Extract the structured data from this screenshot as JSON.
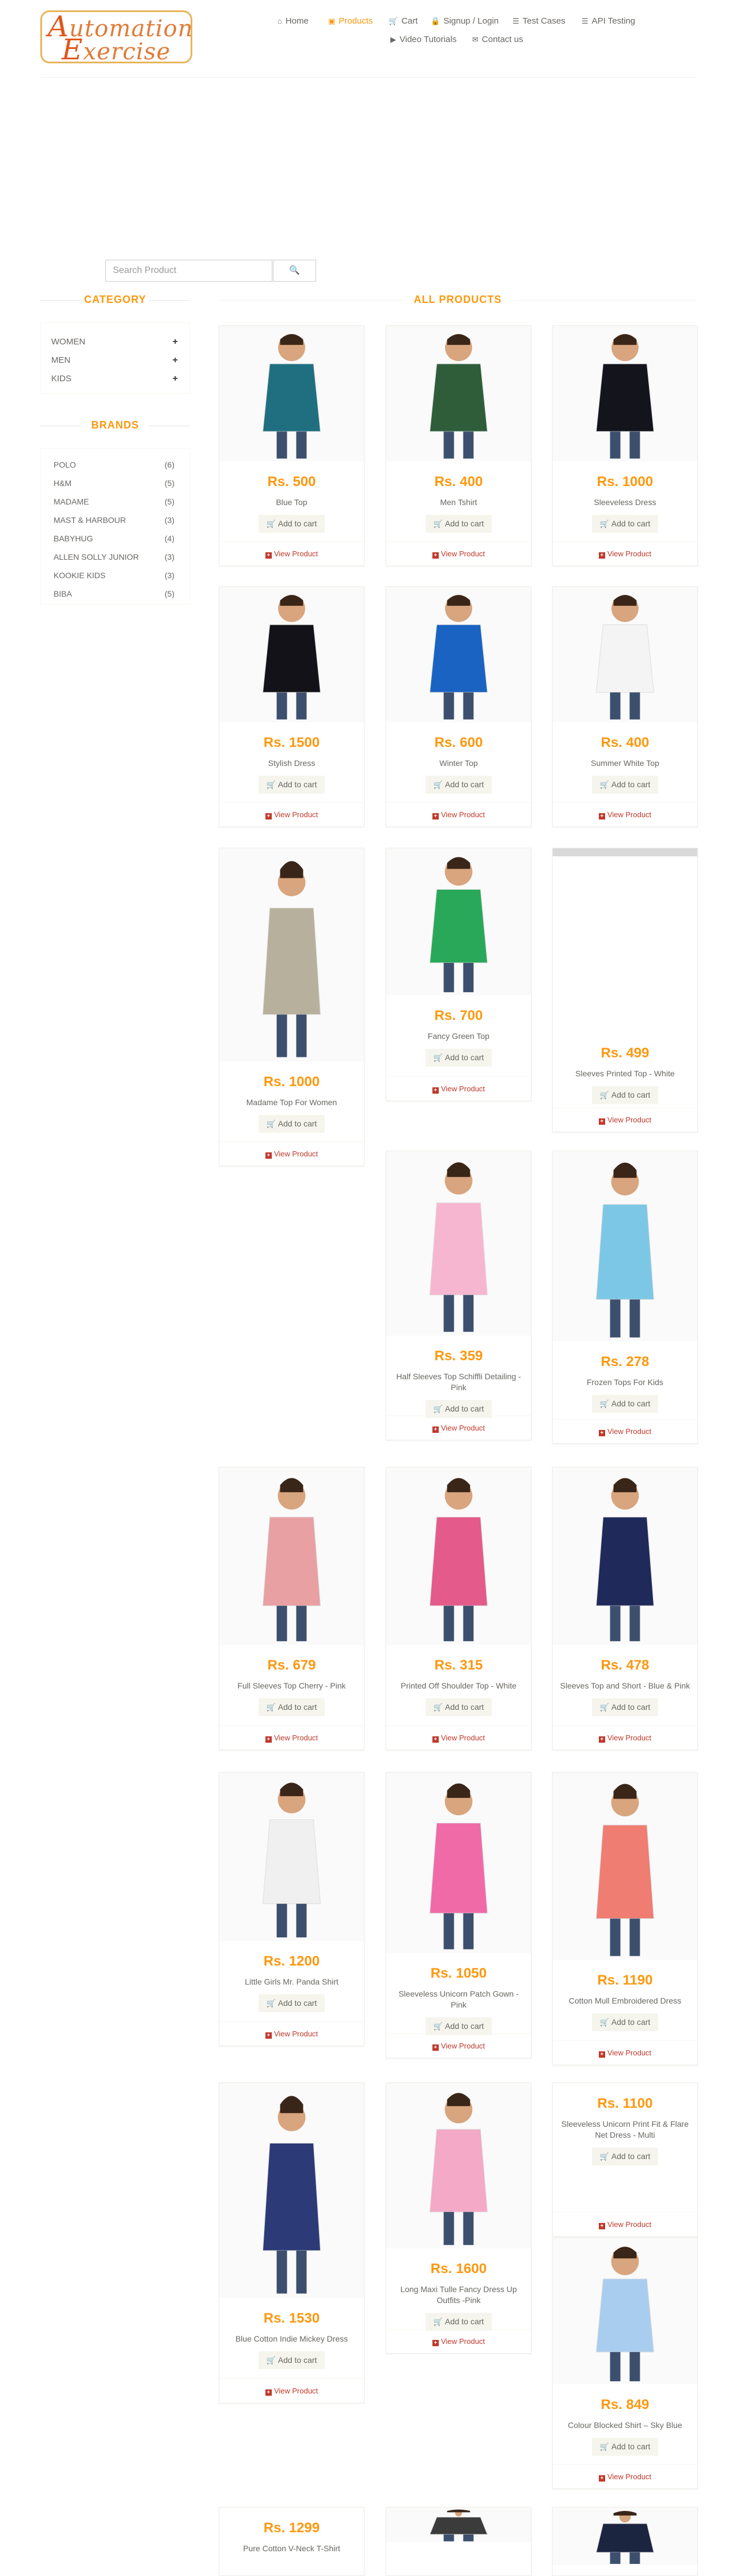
{
  "header": {
    "logo": {
      "line1": "Automation",
      "line2": "Exercise"
    },
    "nav": [
      {
        "label": "Home",
        "icon": "home-icon",
        "glyph": "⌂",
        "active": false
      },
      {
        "label": "Products",
        "icon": "products-icon",
        "glyph": "▣",
        "active": true
      },
      {
        "label": "Cart",
        "icon": "cart-icon",
        "glyph": "🛒",
        "active": false
      },
      {
        "label": "Signup / Login",
        "icon": "lock-icon",
        "glyph": "🔒",
        "active": false
      },
      {
        "label": "Test Cases",
        "icon": "list-icon",
        "glyph": "☰",
        "active": false
      },
      {
        "label": "API Testing",
        "icon": "list-icon",
        "glyph": "☰",
        "active": false
      },
      {
        "label": "Video Tutorials",
        "icon": "youtube-icon",
        "glyph": "▶",
        "active": false
      },
      {
        "label": "Contact us",
        "icon": "envelope-icon",
        "glyph": "✉",
        "active": false
      }
    ]
  },
  "search": {
    "placeholder": "Search Product",
    "button_icon": "search-icon",
    "button_glyph": "🔍"
  },
  "sidebar": {
    "category_title": "CATEGORY",
    "categories": [
      {
        "label": "WOMEN",
        "toggle": "+"
      },
      {
        "label": "MEN",
        "toggle": "+"
      },
      {
        "label": "KIDS",
        "toggle": "+"
      }
    ],
    "brands_title": "BRANDS",
    "brands": [
      {
        "label": "POLO",
        "count": "(6)"
      },
      {
        "label": "H&M",
        "count": "(5)"
      },
      {
        "label": "MADAME",
        "count": "(5)"
      },
      {
        "label": "MAST & HARBOUR",
        "count": "(3)"
      },
      {
        "label": "BABYHUG",
        "count": "(4)"
      },
      {
        "label": "ALLEN SOLLY JUNIOR",
        "count": "(3)"
      },
      {
        "label": "KOOKIE KIDS",
        "count": "(3)"
      },
      {
        "label": "BIBA",
        "count": "(5)"
      }
    ]
  },
  "products_section": {
    "title": "ALL PRODUCTS",
    "add_to_cart": "Add to cart",
    "view_product": "View Product"
  },
  "products": [
    {
      "name": "Blue Top",
      "price": "Rs. 500",
      "color": "#1f6f80"
    },
    {
      "name": "Men Tshirt",
      "price": "Rs. 400",
      "color": "#2f5d3a"
    },
    {
      "name": "Sleeveless Dress",
      "price": "Rs. 1000",
      "color": "#14141c"
    },
    {
      "name": "Stylish Dress",
      "price": "Rs. 1500",
      "color": "#121218"
    },
    {
      "name": "Winter Top",
      "price": "Rs. 600",
      "color": "#1a63c2"
    },
    {
      "name": "Summer White Top",
      "price": "Rs. 400",
      "color": "#f4f4f4"
    },
    {
      "name": "Madame Top For Women",
      "price": "Rs. 1000",
      "color": "#b7b09c"
    },
    {
      "name": "Fancy Green Top",
      "price": "Rs. 700",
      "color": "#2aa85a"
    },
    {
      "name": "Sleeves Printed Top - White",
      "price": "Rs. 499",
      "color": "#f2f2f2"
    },
    {
      "name": "Half Sleeves Top Schiffli Detailing - Pink",
      "price": "Rs. 359",
      "color": "#f7b6cf"
    },
    {
      "name": "Frozen Tops For Kids",
      "price": "Rs. 278",
      "color": "#7cc7e6"
    },
    {
      "name": "Full Sleeves Top Cherry - Pink",
      "price": "Rs. 679",
      "color": "#e8a0a2"
    },
    {
      "name": "Printed Off Shoulder Top - White",
      "price": "Rs. 315",
      "color": "#e45a8a"
    },
    {
      "name": "Sleeves Top and Short - Blue & Pink",
      "price": "Rs. 478",
      "color": "#1f2a5a"
    },
    {
      "name": "Little Girls Mr. Panda Shirt",
      "price": "Rs. 1200",
      "color": "#f0f0f0"
    },
    {
      "name": "Sleeveless Unicorn Patch Gown - Pink",
      "price": "Rs. 1050",
      "color": "#f06aa8"
    },
    {
      "name": "Cotton Mull Embroidered Dress",
      "price": "Rs. 1190",
      "color": "#ef7d72"
    },
    {
      "name": "Blue Cotton Indie Mickey Dress",
      "price": "Rs. 1530",
      "color": "#2c3a78"
    },
    {
      "name": "Long Maxi Tulle Fancy Dress Up Outfits -Pink",
      "price": "Rs. 1600",
      "color": "#f4a9c6"
    },
    {
      "name": "Sleeveless Unicorn Print Fit & Flare Net Dress - Multi",
      "price": "Rs. 1100",
      "color": "#ffffff"
    },
    {
      "name": "Colour Blocked Shirt – Sky Blue",
      "price": "Rs. 849",
      "color": "#a9cdee"
    },
    {
      "name": "Pure Cotton V-Neck T-Shirt",
      "price": "Rs. 1299",
      "color": "#ffffff"
    },
    {
      "name": "",
      "price": "",
      "color": "#3b3b3b"
    },
    {
      "name": "",
      "price": "",
      "color": "#1c2540"
    }
  ]
}
